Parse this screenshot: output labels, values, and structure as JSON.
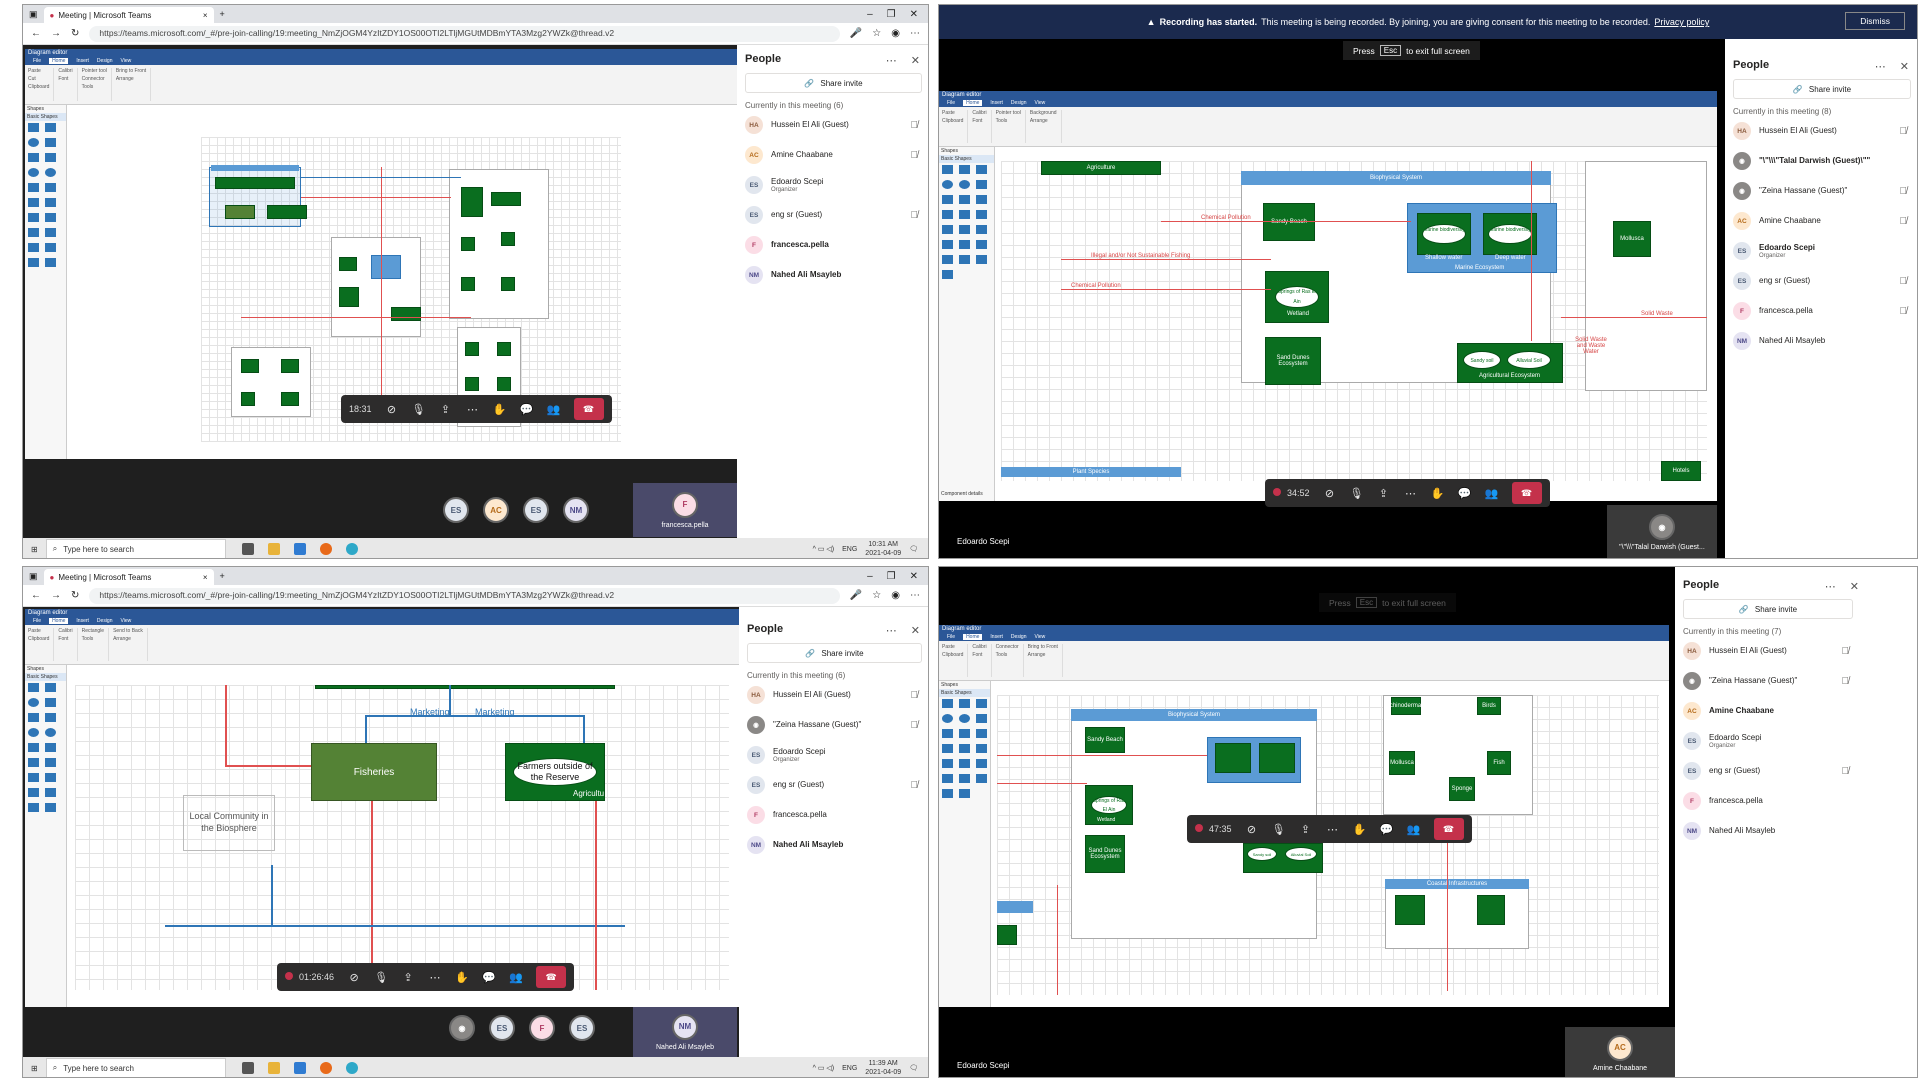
{
  "browser": {
    "tab_title": "Meeting | Microsoft Teams",
    "url": "https://teams.microsoft.com/_#/pre-join-calling/19:meeting_NmZjOGM4YzItZDY1OS00OTI2LTljMGUtMDBmYTA3Mzg2YWZk@thread.v2",
    "new_tab": "+"
  },
  "visio": {
    "title": "Diagram editor",
    "tabs": [
      "File",
      "Home",
      "Insert",
      "Design",
      "View"
    ],
    "ribbon_groups": [
      "Clipboard",
      "Font",
      "Paragraph",
      "Tools",
      "Shape styles",
      "Arrange"
    ],
    "ribbon_items": [
      "Paste",
      "Cut",
      "Copy",
      "Format painter",
      "Calibri",
      "Pointer tool",
      "Connector",
      "Rectangle",
      "Background",
      "Bring to Front",
      "Send to Back"
    ],
    "shapes_panel": {
      "title": "Shapes",
      "search": "Enter text to search",
      "items": [
        "More Shapes",
        "Quick Shapes",
        "Basic Shapes",
        "Basic Flowchart Shapes"
      ]
    },
    "status": "Component details"
  },
  "quadrant1": {
    "call_time": "18:31",
    "avatars": [
      "ES",
      "AC",
      "ES",
      "NM"
    ],
    "pip_initial": "F",
    "pip_name": "francesca.pella",
    "people": {
      "title": "People",
      "share": "Share invite",
      "section": "Currently in this meeting (6)",
      "members": [
        {
          "initials": "HA",
          "name": "Hussein El Ali (Guest)",
          "muted": true,
          "bold": false,
          "color": "#f5e1d6",
          "fg": "#8a5a3c"
        },
        {
          "initials": "AC",
          "name": "Amine Chaabane",
          "muted": true,
          "bold": false,
          "color": "#fde8cf",
          "fg": "#b46a1a"
        },
        {
          "initials": "ES",
          "name": "Edoardo Scepi",
          "role": "Organizer",
          "muted": false,
          "bold": false,
          "color": "#e1e6ee",
          "fg": "#4a5a74"
        },
        {
          "initials": "ES",
          "name": "eng sr (Guest)",
          "muted": true,
          "bold": false,
          "color": "#e1e6ee",
          "fg": "#4a5a74"
        },
        {
          "initials": "F",
          "name": "francesca.pella",
          "muted": false,
          "bold": true,
          "color": "#fbdde6",
          "fg": "#b03a62"
        },
        {
          "initials": "NM",
          "name": "Nahed Ali Msayleb",
          "muted": false,
          "bold": true,
          "color": "#e5e3f2",
          "fg": "#4f4b8a"
        }
      ]
    },
    "taskbar": {
      "search": "Type here to search",
      "lang": "ENG",
      "time": "10:31 AM",
      "date": "2021-04-09"
    }
  },
  "quadrant2": {
    "banner": {
      "strong": "Recording has started.",
      "text": "This meeting is being recorded. By joining, you are giving consent for this meeting to be recorded.",
      "link": "Privacy policy",
      "dismiss": "Dismiss"
    },
    "press": "Press",
    "esc": "Esc",
    "exit": "to exit full screen",
    "call_time": "34:52",
    "presenter": "Edoardo Scepi",
    "pip_name": "\"\\\"\\\\\\\"Talal Darwish (Guest...",
    "people": {
      "title": "People",
      "share": "Share invite",
      "section": "Currently in this meeting (8)",
      "members": [
        {
          "initials": "HA",
          "name": "Hussein El Ali (Guest)",
          "muted": true,
          "bold": false,
          "color": "#f5e1d6",
          "fg": "#8a5a3c"
        },
        {
          "initials": "",
          "name": "\"\\\"\\\\\\\"Talal Darwish (Guest)\\\"\"",
          "muted": false,
          "bold": true,
          "color": "#8a8886",
          "fg": "#fff"
        },
        {
          "initials": "",
          "name": "\"Zeina Hassane (Guest)\"",
          "muted": true,
          "bold": false,
          "color": "#8a8886",
          "fg": "#fff"
        },
        {
          "initials": "AC",
          "name": "Amine Chaabane",
          "muted": true,
          "bold": false,
          "color": "#fde8cf",
          "fg": "#b46a1a"
        },
        {
          "initials": "ES",
          "name": "Edoardo Scepi",
          "role": "Organizer",
          "muted": false,
          "bold": true,
          "color": "#e1e6ee",
          "fg": "#4a5a74"
        },
        {
          "initials": "ES",
          "name": "eng sr (Guest)",
          "muted": true,
          "bold": false,
          "color": "#e1e6ee",
          "fg": "#4a5a74"
        },
        {
          "initials": "F",
          "name": "francesca.pella",
          "muted": true,
          "bold": false,
          "color": "#fbdde6",
          "fg": "#b03a62"
        },
        {
          "initials": "NM",
          "name": "Nahed Ali Msayleb",
          "muted": false,
          "bold": false,
          "color": "#e5e3f2",
          "fg": "#4f4b8a"
        }
      ]
    },
    "diagram": {
      "agriculture": "Agriculture",
      "bio_header": "Biophysical System",
      "sandy": "Sandy Beach",
      "springs": "Springs of Ras El Ain",
      "wetland": "Wetland",
      "dunes": "Sand Dunes Ecosystem",
      "marine1": "Marine biodiversity",
      "shallow": "Shallow water",
      "marine2": "Marine biodiversity",
      "deep": "Deep water",
      "marine_eco": "Marine Ecosystem",
      "sandy_soil": "Sandy soil",
      "alluvial": "Alluvial Soil",
      "agri_eco": "Agricultural Ecosystem",
      "mollusca": "Mollusca",
      "chem1": "Chemical Pollution",
      "illegal": "Illegal and/or Not Sustainable Fishing",
      "chem2": "Chemical Pollution",
      "solid1": "Solid Waste and Waste Water",
      "solid2": "Solid Waste",
      "plant": "Plant Species",
      "hotels": "Hotels"
    }
  },
  "quadrant3": {
    "call_time": "01:26:46",
    "avatars": [
      "",
      "ES",
      "F",
      "ES"
    ],
    "pip_initial": "NM",
    "pip_name": "Nahed Ali Msayleb",
    "people": {
      "title": "People",
      "share": "Share invite",
      "section": "Currently in this meeting (6)",
      "members": [
        {
          "initials": "HA",
          "name": "Hussein El Ali (Guest)",
          "muted": true,
          "bold": false,
          "color": "#f5e1d6",
          "fg": "#8a5a3c"
        },
        {
          "initials": "",
          "name": "\"Zeina Hassane (Guest)\"",
          "muted": true,
          "bold": false,
          "color": "#8a8886",
          "fg": "#fff"
        },
        {
          "initials": "ES",
          "name": "Edoardo Scepi",
          "role": "Organizer",
          "muted": false,
          "bold": false,
          "color": "#e1e6ee",
          "fg": "#4a5a74"
        },
        {
          "initials": "ES",
          "name": "eng sr (Guest)",
          "muted": true,
          "bold": false,
          "color": "#e1e6ee",
          "fg": "#4a5a74"
        },
        {
          "initials": "F",
          "name": "francesca.pella",
          "muted": false,
          "bold": false,
          "color": "#fbdde6",
          "fg": "#b03a62"
        },
        {
          "initials": "NM",
          "name": "Nahed Ali Msayleb",
          "muted": false,
          "bold": true,
          "color": "#e5e3f2",
          "fg": "#4f4b8a"
        }
      ]
    },
    "diagram": {
      "marketing1": "Marketing",
      "marketing2": "Marketing",
      "fisheries": "Fisheries",
      "farmers": "Farmers outside of the Reserve",
      "agri": "Agricultu",
      "local": "Local Community in the Biosphere"
    },
    "taskbar": {
      "search": "Type here to search",
      "lang": "ENG",
      "time": "11:39 AM",
      "date": "2021-04-09"
    }
  },
  "quadrant4": {
    "press": "Press",
    "esc": "Esc",
    "exit": "to exit full screen",
    "call_time": "47:35",
    "presenter": "Edoardo Scepi",
    "pip_initial": "AC",
    "pip_name": "Amine Chaabane",
    "people": {
      "title": "People",
      "share": "Share invite",
      "section": "Currently in this meeting (7)",
      "members": [
        {
          "initials": "HA",
          "name": "Hussein El Ali (Guest)",
          "muted": true,
          "bold": false,
          "color": "#f5e1d6",
          "fg": "#8a5a3c"
        },
        {
          "initials": "",
          "name": "\"Zeina Hassane (Guest)\"",
          "muted": true,
          "bold": false,
          "color": "#8a8886",
          "fg": "#fff"
        },
        {
          "initials": "AC",
          "name": "Amine Chaabane",
          "muted": false,
          "bold": true,
          "color": "#fde8cf",
          "fg": "#b46a1a"
        },
        {
          "initials": "ES",
          "name": "Edoardo Scepi",
          "role": "Organizer",
          "muted": false,
          "bold": false,
          "color": "#e1e6ee",
          "fg": "#4a5a74"
        },
        {
          "initials": "ES",
          "name": "eng sr (Guest)",
          "muted": true,
          "bold": false,
          "color": "#e1e6ee",
          "fg": "#4a5a74"
        },
        {
          "initials": "F",
          "name": "francesca.pella",
          "muted": false,
          "bold": false,
          "color": "#fbdde6",
          "fg": "#b03a62"
        },
        {
          "initials": "NM",
          "name": "Nahed Ali Msayleb",
          "muted": false,
          "bold": false,
          "color": "#e5e3f2",
          "fg": "#4f4b8a"
        }
      ]
    },
    "diagram": {
      "bio_header": "Biophysical System",
      "coastal": "Coastal Infrastructures",
      "sandy": "Sandy Beach",
      "springs": "Springs of Ras El Ain",
      "wetland": "Wetland",
      "dunes": "Sand Dunes Ecosystem",
      "sandy_soil": "Sandy soil",
      "alluvial": "Alluvial Soil",
      "mollusca": "Mollusca",
      "fish": "Fish",
      "sponge": "Sponge",
      "echino": "Echinodermata",
      "birds": "Birds"
    }
  },
  "colors": {
    "teams_purple": "#6264a7",
    "hangup": "#c4314b",
    "shape_green": "#0a6e1f",
    "visio_blue": "#2b5797"
  }
}
